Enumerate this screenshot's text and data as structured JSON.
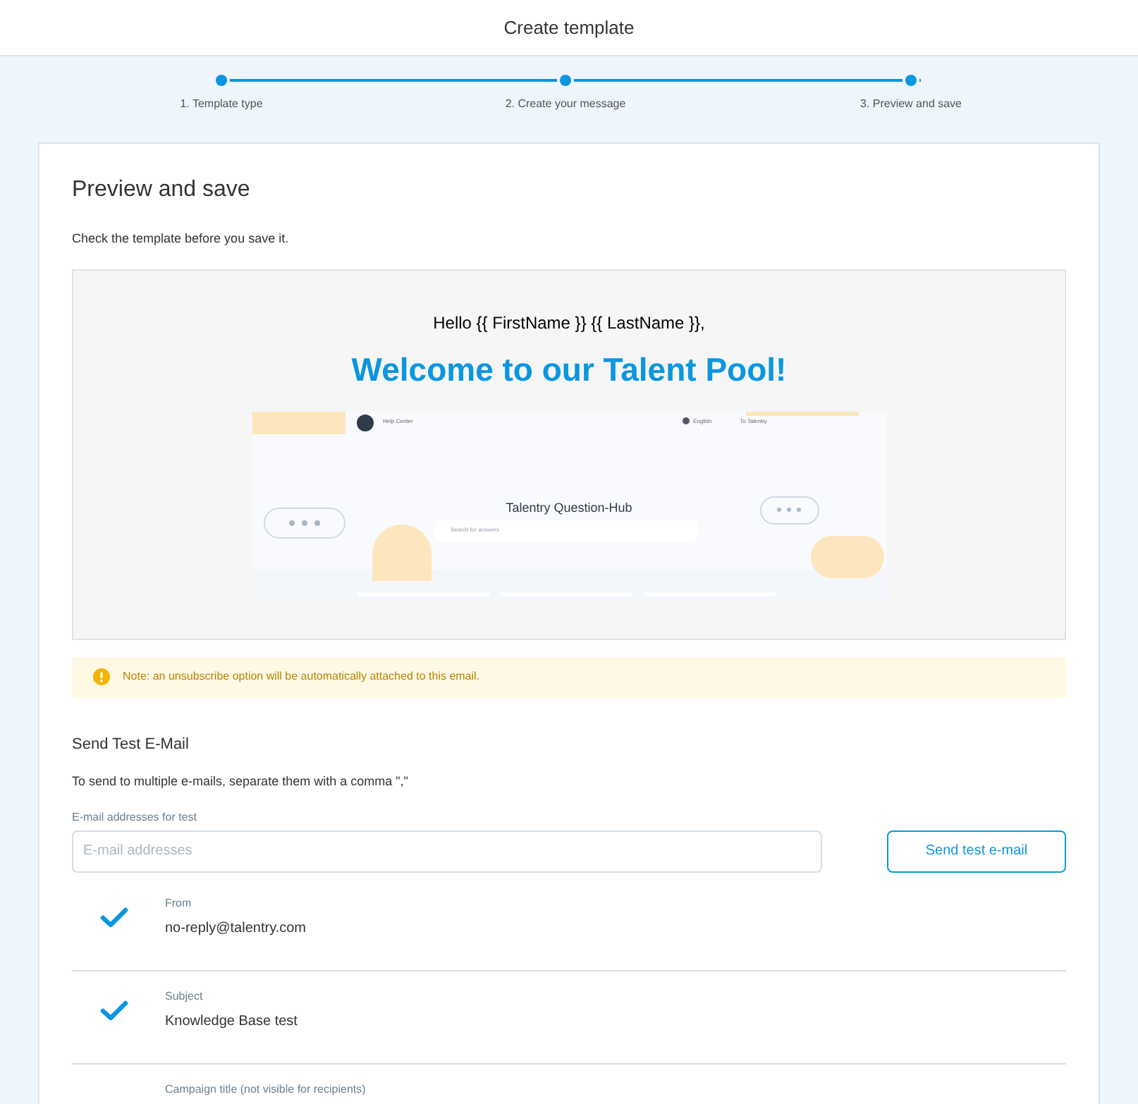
{
  "header": {
    "title": "Create template"
  },
  "steps": [
    {
      "label": "1. Template type",
      "done": true
    },
    {
      "label": "2. Create your message",
      "done": true
    },
    {
      "label": "3. Preview and save",
      "done": true
    }
  ],
  "card": {
    "title": "Preview and save",
    "subtitle": "Check the template before you save it."
  },
  "preview": {
    "greeting": "Hello {{ FirstName }} {{ LastName }},",
    "headline": "Welcome to our Talent Pool!",
    "embedded_screenshot": {
      "nav_link": "Help Center",
      "language": "English",
      "external_link": "To Talentry",
      "title": "Talentry Question-Hub",
      "search_placeholder": "Search for answers"
    }
  },
  "note": "Note: an unsubscribe option will be automatically attached to this email.",
  "test_email": {
    "title": "Send Test E-Mail",
    "hint": "To send to multiple e-mails, separate them with a comma \",\"",
    "field_label": "E-mail addresses for test",
    "placeholder": "E-mail addresses",
    "button": "Send test e-mail"
  },
  "checks": [
    {
      "label": "From",
      "value": "no-reply@talentry.com",
      "checked": true
    },
    {
      "label": "Subject",
      "value": "Knowledge Base test",
      "checked": true
    },
    {
      "label": "Campaign title (not visible for recipients)",
      "checked": false
    }
  ]
}
